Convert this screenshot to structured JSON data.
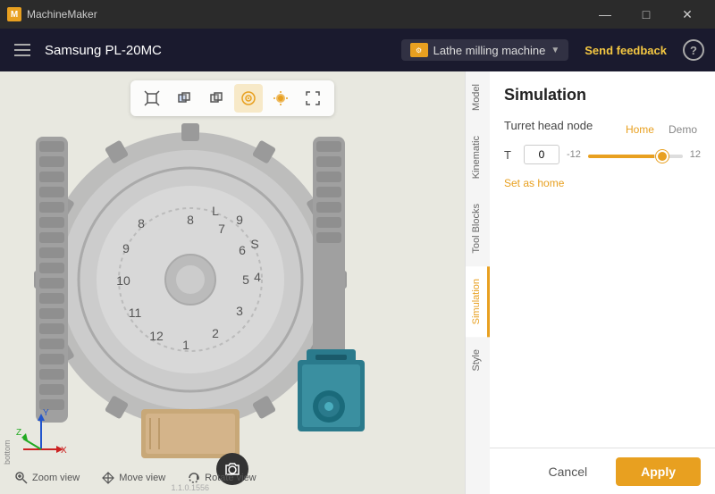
{
  "titlebar": {
    "app_name": "MachineMaker",
    "controls": {
      "minimize": "—",
      "maximize": "□",
      "close": "✕"
    }
  },
  "header": {
    "machine_name": "Samsung PL-20MC",
    "machine_type": "Lathe milling machine",
    "send_feedback": "Send feedback",
    "help": "?"
  },
  "toolbar": {
    "icons": [
      "⬡",
      "⬡",
      "⬡",
      "⊕",
      "◉",
      "✕"
    ]
  },
  "viewport": {
    "view_controls": [
      {
        "label": "Zoom view",
        "icon": "🔍"
      },
      {
        "label": "Move view",
        "icon": "✋"
      },
      {
        "label": "Rotate view",
        "icon": "↻"
      }
    ],
    "bottom_label": "bottom"
  },
  "sidebar": {
    "tabs": [
      {
        "id": "model",
        "label": "Model"
      },
      {
        "id": "kinematic",
        "label": "Kinematic"
      },
      {
        "id": "tool-blocks",
        "label": "Tool Blocks"
      },
      {
        "id": "simulation",
        "label": "Simulation",
        "active": true
      },
      {
        "id": "style",
        "label": "Style"
      }
    ]
  },
  "simulation": {
    "title": "Simulation",
    "turret_head_node": "Turret head node",
    "home_label": "Home",
    "demo_label": "Demo",
    "t_label": "T",
    "t_value": "0",
    "slider_min": "-12",
    "slider_max": "12",
    "slider_value": 70,
    "set_as_home": "Set as home"
  },
  "bottom_bar": {
    "cancel": "Cancel",
    "apply": "Apply"
  },
  "version": "1.1.0.1556"
}
